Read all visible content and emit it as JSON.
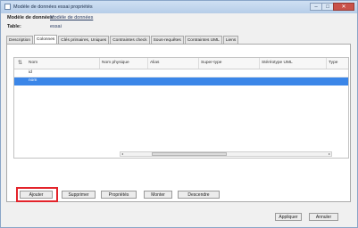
{
  "window": {
    "title": "Modèle de données essai propriétés",
    "min_glyph": "–",
    "max_glyph": "□",
    "close_glyph": "✕"
  },
  "fields": {
    "model_label": "Modèle de données:",
    "model_value": "Modèle de données",
    "table_label": "Table:",
    "table_value": "essai"
  },
  "tabs": [
    {
      "label": "Description"
    },
    {
      "label": "Colonnes"
    },
    {
      "label": "Clés primaires, Uniques"
    },
    {
      "label": "Contraintes check"
    },
    {
      "label": "Sous-requêtes"
    },
    {
      "label": "Contraintes UML"
    },
    {
      "label": "Liens"
    }
  ],
  "table": {
    "columns": [
      "Nom",
      "Nom physique",
      "Alias",
      "Super-type",
      "Stéréotype UML",
      "Type"
    ],
    "rows": [
      {
        "name": "id",
        "selected": false
      },
      {
        "name": "nom",
        "selected": true
      }
    ]
  },
  "buttons": {
    "add": "Ajouter",
    "delete": "Supprimer",
    "properties": "Propriétés",
    "move_up": "Monter",
    "move_down": "Descendre",
    "apply": "Appliquer",
    "cancel": "Annuler"
  },
  "scrollbar": {
    "left_arrow": "◂",
    "right_arrow": "▸"
  },
  "colors": {
    "selection": "#3b86e8",
    "highlight": "#e3242b"
  }
}
